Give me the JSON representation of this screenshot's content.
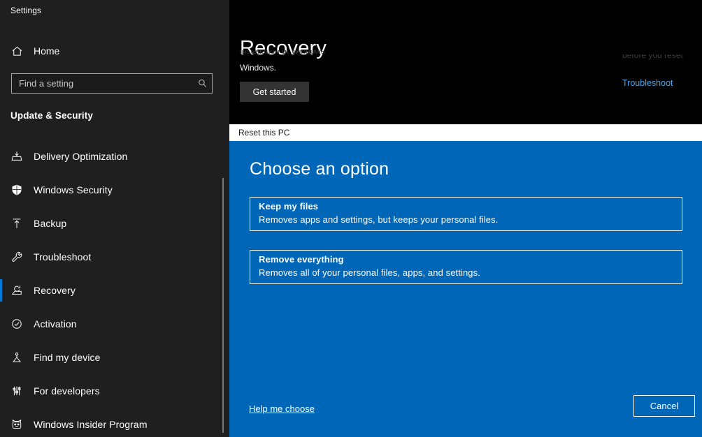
{
  "window": {
    "title": "Settings"
  },
  "sidebar": {
    "home": {
      "label": "Home",
      "icon": "home-icon"
    },
    "search": {
      "placeholder": "Find a setting",
      "value": "",
      "icon": "search-icon"
    },
    "section_title": "Update & Security",
    "items": [
      {
        "label": "Delivery Optimization",
        "icon": "delivery-optimization-icon",
        "selected": false
      },
      {
        "label": "Windows Security",
        "icon": "shield-icon",
        "selected": false
      },
      {
        "label": "Backup",
        "icon": "backup-upload-icon",
        "selected": false
      },
      {
        "label": "Troubleshoot",
        "icon": "wrench-icon",
        "selected": false
      },
      {
        "label": "Recovery",
        "icon": "recovery-icon",
        "selected": true
      },
      {
        "label": "Activation",
        "icon": "check-circle-icon",
        "selected": false
      },
      {
        "label": "Find my device",
        "icon": "location-pin-icon",
        "selected": false
      },
      {
        "label": "For developers",
        "icon": "sliders-icon",
        "selected": false
      },
      {
        "label": "Windows Insider Program",
        "icon": "insider-cat-icon",
        "selected": false
      }
    ]
  },
  "right_pane": {
    "heading": "Recovery",
    "subtitle_clipped_above": "installation of Windows",
    "subtitle_line": "Windows.",
    "get_started_label": "Get started",
    "right_column_clipped": "before you reset",
    "troubleshoot_link": "Troubleshoot"
  },
  "dialog": {
    "titlebar_text": "Reset this PC",
    "heading": "Choose an option",
    "options": [
      {
        "title": "Keep my files",
        "desc": "Removes apps and settings, but keeps your personal files."
      },
      {
        "title": "Remove everything",
        "desc": "Removes all of your personal files, apps, and settings."
      }
    ],
    "help_link": "Help me choose",
    "cancel_label": "Cancel"
  },
  "colors": {
    "dialog_blue": "#0067b8",
    "sidebar_bg": "#1f1f1f",
    "pane_bg": "#000000",
    "accent_selection": "#0078d7",
    "link_blue": "#4da3e0",
    "titlebar_bg": "#ffffff"
  }
}
